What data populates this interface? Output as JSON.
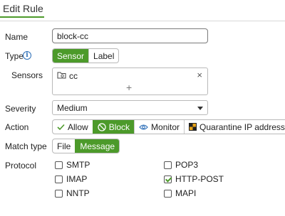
{
  "header": {
    "title": "Edit Rule"
  },
  "form": {
    "name": {
      "label": "Name",
      "value": "block-cc"
    },
    "type": {
      "label": "Type",
      "options": [
        "Sensor",
        "Label"
      ],
      "selected": "Sensor",
      "info_icon": "info-icon"
    },
    "sensors": {
      "label": "Sensors",
      "items": [
        {
          "label": "cc",
          "icon": "sensor-folder-icon"
        }
      ],
      "add_symbol": "+",
      "remove_symbol": "×"
    },
    "severity": {
      "label": "Severity",
      "value": "Medium"
    },
    "action": {
      "label": "Action",
      "options": [
        {
          "label": "Allow",
          "icon": "check-icon"
        },
        {
          "label": "Block",
          "icon": "block-icon"
        },
        {
          "label": "Monitor",
          "icon": "eye-icon"
        },
        {
          "label": "Quarantine IP address",
          "icon": "quarantine-icon"
        }
      ],
      "selected": "Block"
    },
    "match_type": {
      "label": "Match type",
      "options": [
        "File",
        "Message"
      ],
      "selected": "Message"
    },
    "protocol": {
      "label": "Protocol",
      "options": [
        {
          "label": "SMTP",
          "checked": false
        },
        {
          "label": "POP3",
          "checked": false
        },
        {
          "label": "IMAP",
          "checked": false
        },
        {
          "label": "HTTP-POST",
          "checked": true
        },
        {
          "label": "NNTP",
          "checked": false
        },
        {
          "label": "MAPI",
          "checked": false
        }
      ]
    }
  },
  "colors": {
    "accent": "#4c9a2a",
    "info": "#2d6fb8"
  }
}
